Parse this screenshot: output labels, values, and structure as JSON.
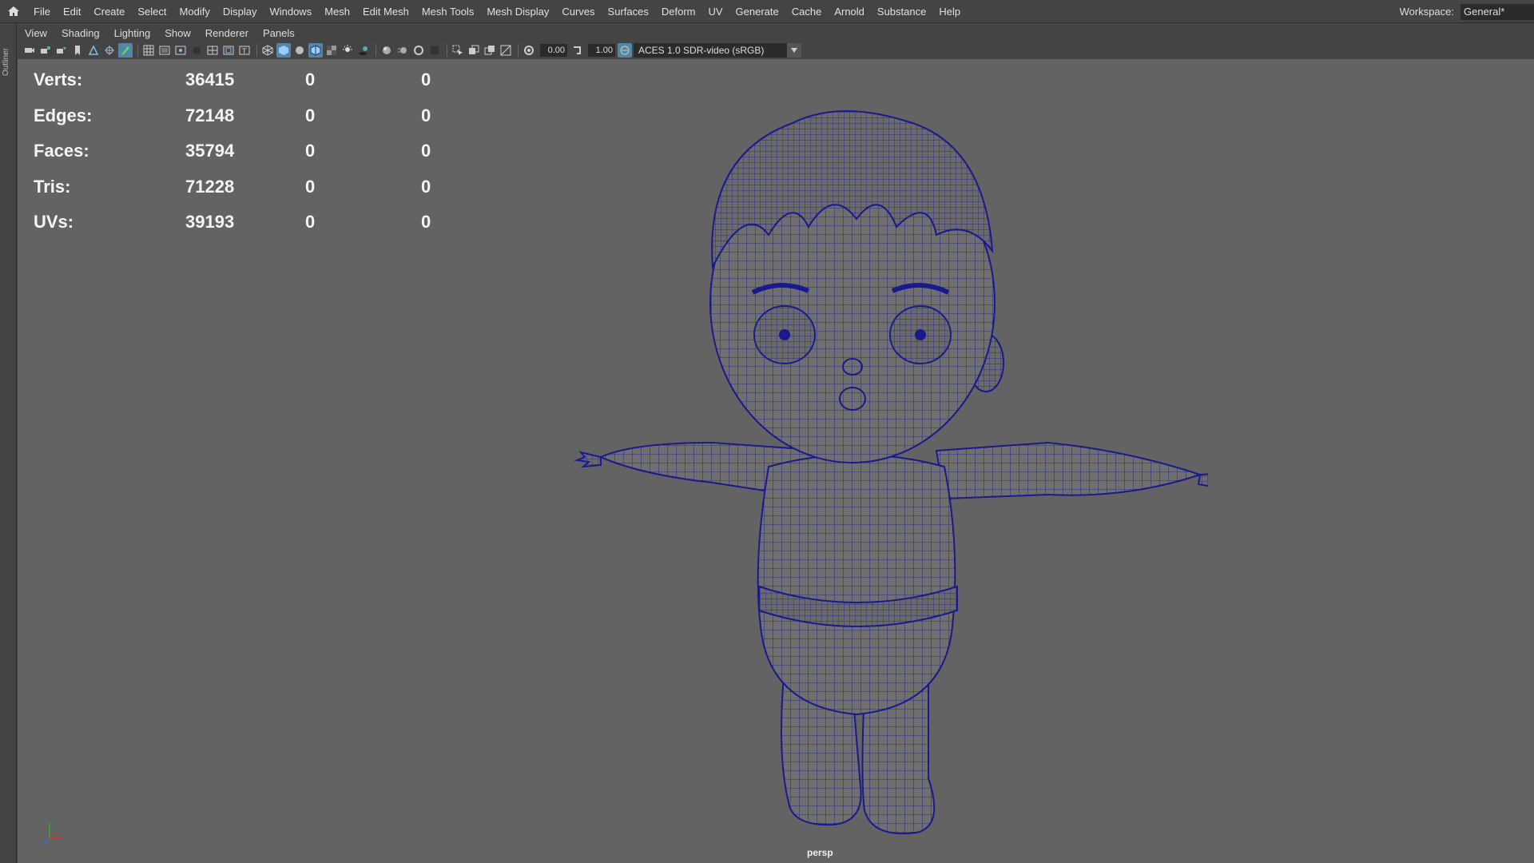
{
  "menubar": {
    "items": [
      "File",
      "Edit",
      "Create",
      "Select",
      "Modify",
      "Display",
      "Windows",
      "Mesh",
      "Edit Mesh",
      "Mesh Tools",
      "Mesh Display",
      "Curves",
      "Surfaces",
      "Deform",
      "UV",
      "Generate",
      "Cache",
      "Arnold",
      "Substance",
      "Help"
    ],
    "workspace_label": "Workspace:",
    "workspace_value": "General*"
  },
  "outliner": {
    "tab_label": "Outliner"
  },
  "panel_menu": {
    "items": [
      "View",
      "Shading",
      "Lighting",
      "Show",
      "Renderer",
      "Panels"
    ]
  },
  "toolbar": {
    "exposure_value": "0.00",
    "gamma_value": "1.00",
    "color_space": "ACES 1.0 SDR-video (sRGB)"
  },
  "hud": {
    "rows": [
      {
        "label": "Verts:",
        "value": "36415",
        "z1": "0",
        "z2": "0"
      },
      {
        "label": "Edges:",
        "value": "72148",
        "z1": "0",
        "z2": "0"
      },
      {
        "label": "Faces:",
        "value": "35794",
        "z1": "0",
        "z2": "0"
      },
      {
        "label": "Tris:",
        "value": "71228",
        "z1": "0",
        "z2": "0"
      },
      {
        "label": "UVs:",
        "value": "39193",
        "z1": "0",
        "z2": "0"
      }
    ]
  },
  "viewport": {
    "camera": "persp",
    "background_color": "#636363",
    "wire_color": "#1a1a8c"
  }
}
